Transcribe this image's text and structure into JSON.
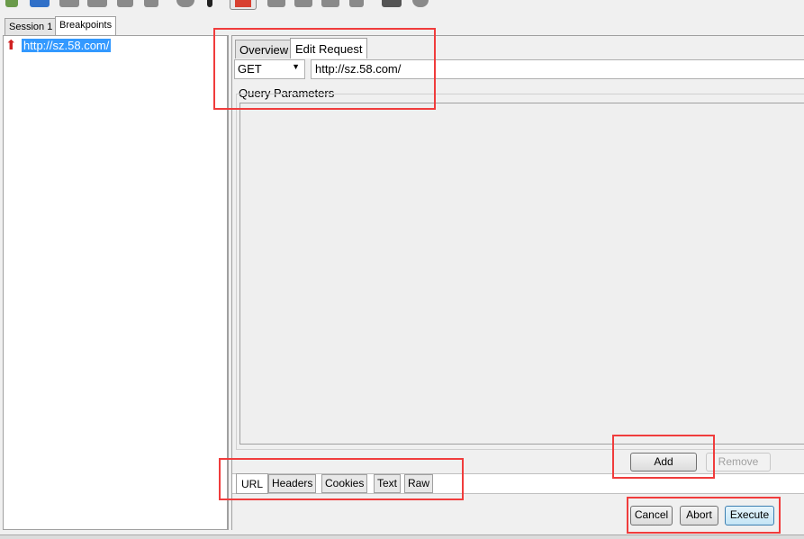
{
  "toolbar": {
    "icons": [
      "new-icon",
      "open-icon",
      "save-icon",
      "save-all-icon",
      "clear-icon",
      "settings-icon",
      "record-icon",
      "pointer-icon",
      "breakpoint-stop-icon",
      "edit-icon",
      "repeat-icon",
      "validate-icon",
      "down-icon",
      "tools-icon",
      "gear-icon"
    ]
  },
  "session_tabs": [
    {
      "label": "Session 1"
    },
    {
      "label": "Breakpoints"
    }
  ],
  "breakpoints": [
    {
      "url": "http://sz.58.com/"
    }
  ],
  "editor_tabs": [
    {
      "label": "Overview"
    },
    {
      "label": "Edit Request"
    }
  ],
  "request": {
    "method": "GET",
    "url": "http://sz.58.com/"
  },
  "query_parameters": {
    "title": "Query Parameters",
    "add_label": "Add",
    "remove_label": "Remove"
  },
  "bottom_tabs": [
    {
      "label": "URL"
    },
    {
      "label": "Headers"
    },
    {
      "label": "Cookies"
    },
    {
      "label": "Text"
    },
    {
      "label": "Raw"
    }
  ],
  "actions": {
    "cancel": "Cancel",
    "abort": "Abort",
    "execute": "Execute"
  },
  "colors": {
    "annotation": "#f03c3c",
    "selection": "#3399ff"
  }
}
